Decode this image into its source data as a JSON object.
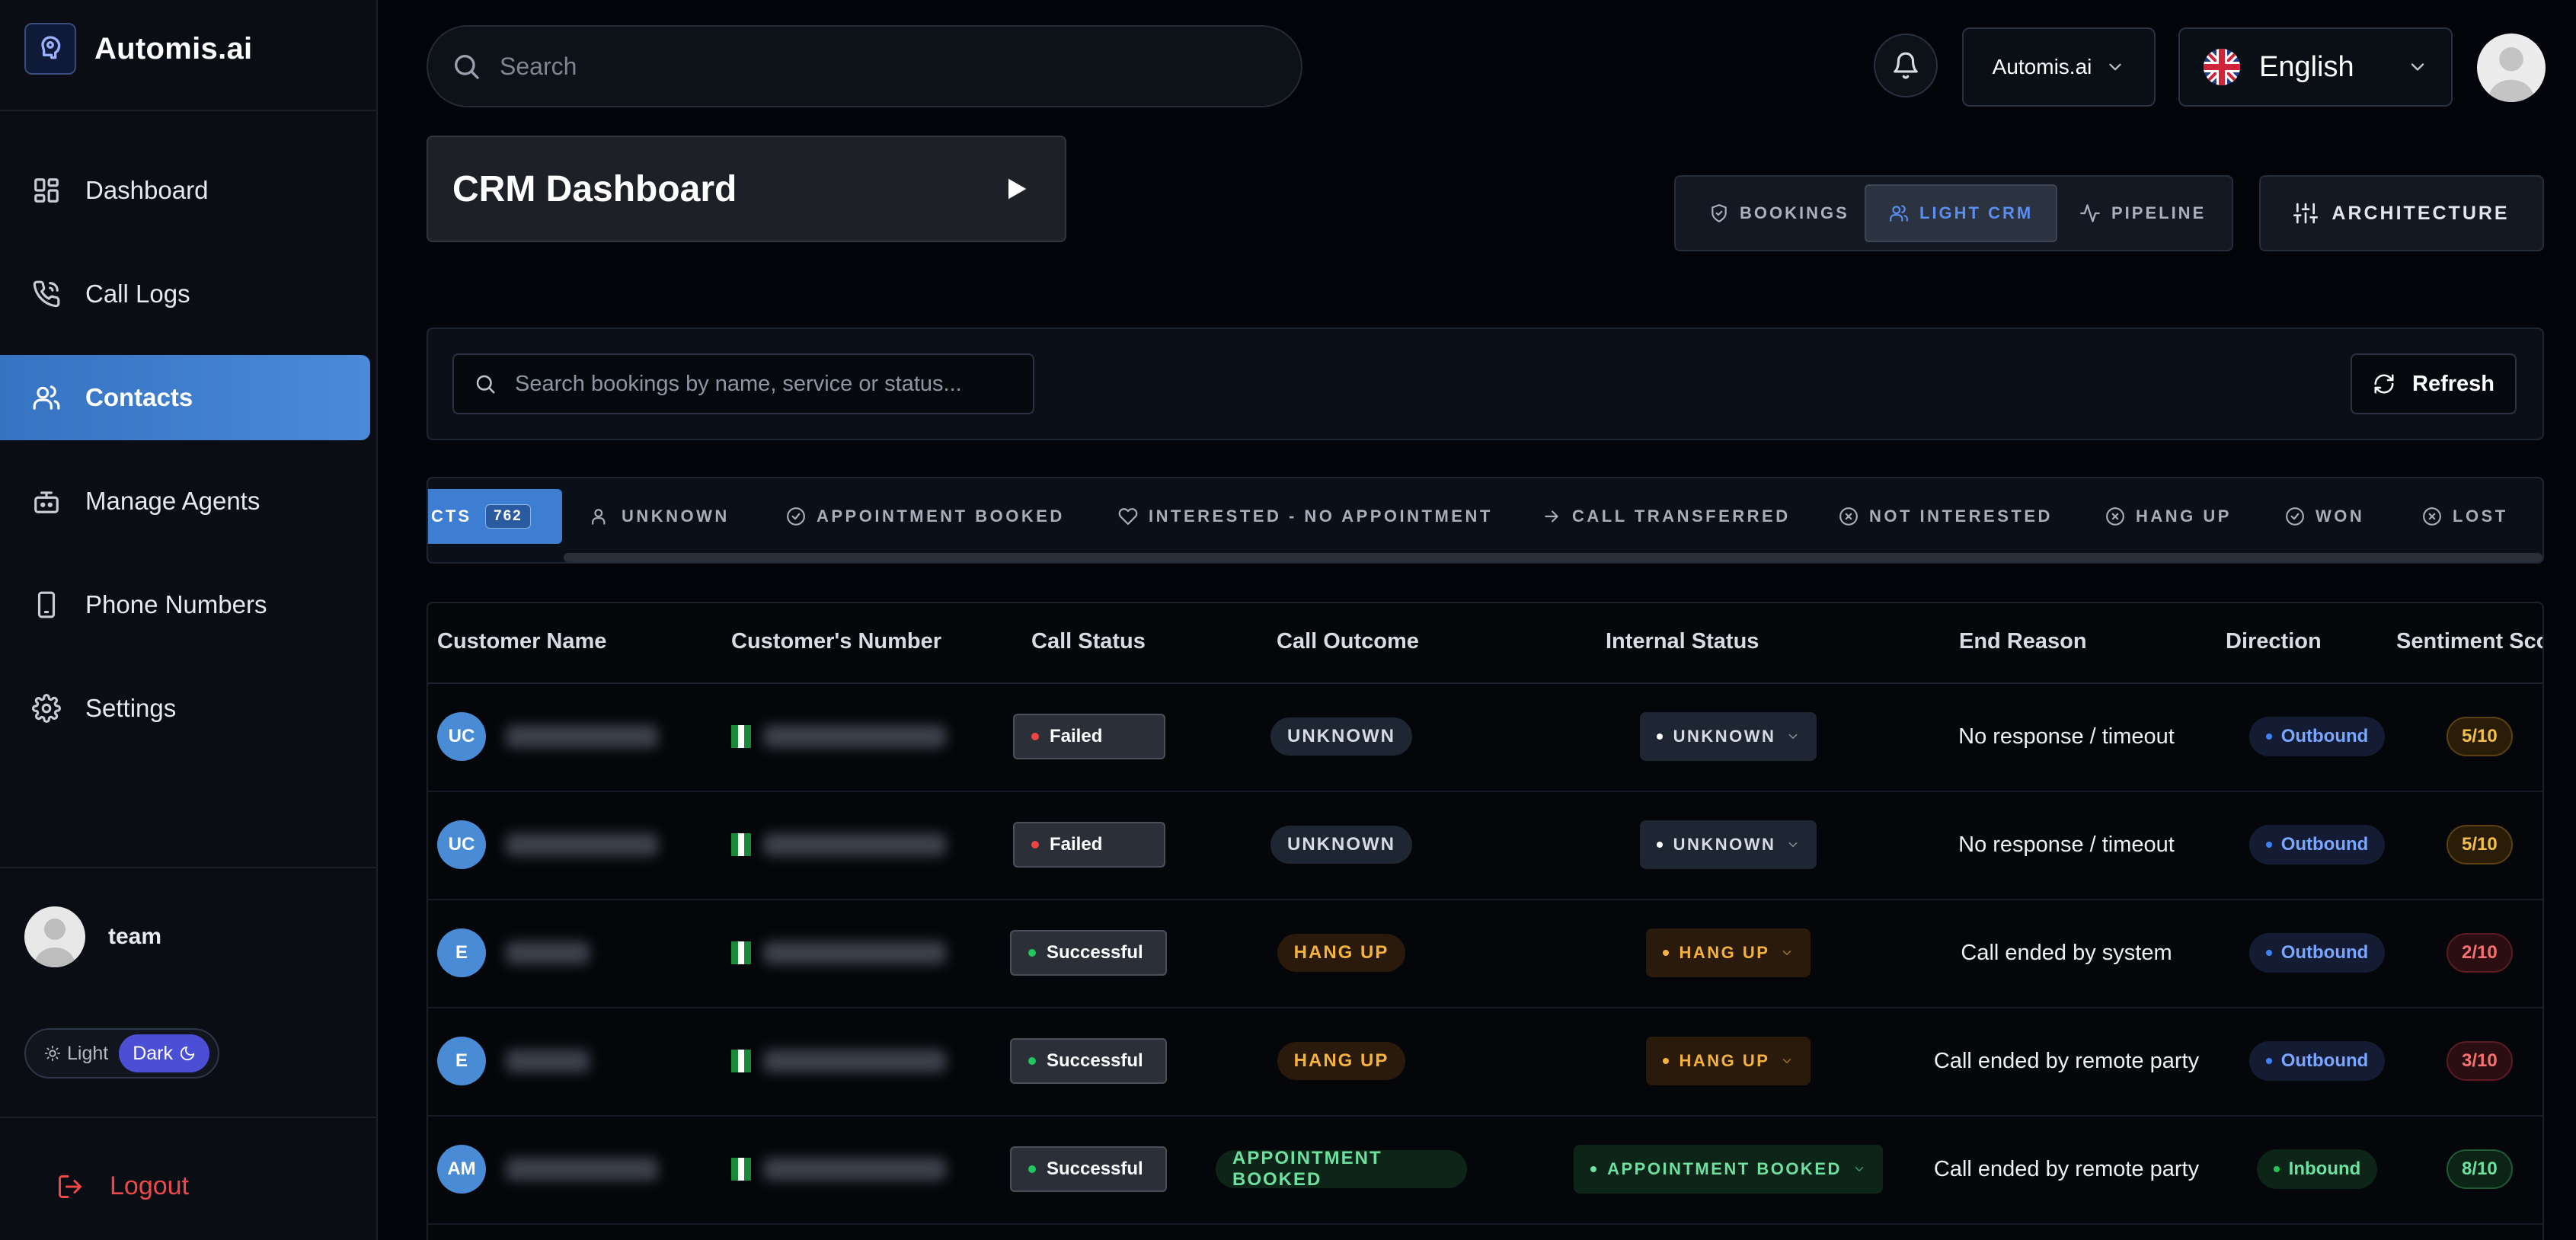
{
  "app": {
    "name": "Automis.ai"
  },
  "sidebar": {
    "items": [
      {
        "label": "Dashboard",
        "icon": "dashboard-icon"
      },
      {
        "label": "Call Logs",
        "icon": "phone-icon"
      },
      {
        "label": "Contacts",
        "icon": "users-icon",
        "active": true
      },
      {
        "label": "Manage Agents",
        "icon": "bot-icon"
      },
      {
        "label": "Phone Numbers",
        "icon": "smartphone-icon"
      },
      {
        "label": "Settings",
        "icon": "gear-icon"
      }
    ],
    "user": {
      "name": "team"
    },
    "theme": {
      "light_label": "Light",
      "dark_label": "Dark",
      "selected": "Dark"
    },
    "logout_label": "Logout"
  },
  "header": {
    "search_placeholder": "Search",
    "org_select": "Automis.ai",
    "language": "English"
  },
  "page": {
    "title": "CRM Dashboard",
    "tabs": [
      {
        "label": "BOOKINGS",
        "icon": "shield-check-icon"
      },
      {
        "label": "LIGHT CRM",
        "icon": "users-icon",
        "active": true
      },
      {
        "label": "PIPELINE",
        "icon": "activity-icon"
      }
    ],
    "architecture_label": "ARCHITECTURE"
  },
  "filters": {
    "search_placeholder": "Search bookings by name, service or status...",
    "refresh_label": "Refresh",
    "active_chip": {
      "label": "CTS",
      "count": "762"
    },
    "chips": [
      {
        "label": "UNKNOWN",
        "icon": "user-icon"
      },
      {
        "label": "APPOINTMENT BOOKED",
        "icon": "check-circle-icon"
      },
      {
        "label": "INTERESTED - NO APPOINTMENT",
        "icon": "heart-icon"
      },
      {
        "label": "CALL TRANSFERRED",
        "icon": "arrow-right-icon"
      },
      {
        "label": "NOT INTERESTED",
        "icon": "x-circle-icon"
      },
      {
        "label": "HANG UP",
        "icon": "x-circle-icon"
      },
      {
        "label": "WON",
        "icon": "check-circle-icon"
      },
      {
        "label": "LOST",
        "icon": "x-circle-icon"
      }
    ]
  },
  "table": {
    "columns": [
      "Customer Name",
      "Customer's Number",
      "Call Status",
      "Call Outcome",
      "Internal Status",
      "End Reason",
      "Direction",
      "Sentiment Sco"
    ],
    "rows": [
      {
        "initials": "UC",
        "call_status": "Failed",
        "call_outcome": "UNKNOWN",
        "internal_status": "UNKNOWN",
        "end_reason": "No response / timeout",
        "direction": "Outbound",
        "sentiment": "5/10"
      },
      {
        "initials": "UC",
        "call_status": "Failed",
        "call_outcome": "UNKNOWN",
        "internal_status": "UNKNOWN",
        "end_reason": "No response / timeout",
        "direction": "Outbound",
        "sentiment": "5/10"
      },
      {
        "initials": "E",
        "call_status": "Successful",
        "call_outcome": "HANG UP",
        "internal_status": "HANG UP",
        "end_reason": "Call ended by system",
        "direction": "Outbound",
        "sentiment": "2/10"
      },
      {
        "initials": "E",
        "call_status": "Successful",
        "call_outcome": "HANG UP",
        "internal_status": "HANG UP",
        "end_reason": "Call ended by remote party",
        "direction": "Outbound",
        "sentiment": "3/10"
      },
      {
        "initials": "AM",
        "call_status": "Successful",
        "call_outcome": "APPOINTMENT BOOKED",
        "internal_status": "APPOINTMENT BOOKED",
        "end_reason": "Call ended by remote party",
        "direction": "Inbound",
        "sentiment": "8/10"
      }
    ]
  },
  "colors": {
    "accent": "#3d7ed3",
    "failed": "#ef4444",
    "success": "#22c55e",
    "warning": "#f59e0b",
    "danger_text": "#f87171"
  }
}
